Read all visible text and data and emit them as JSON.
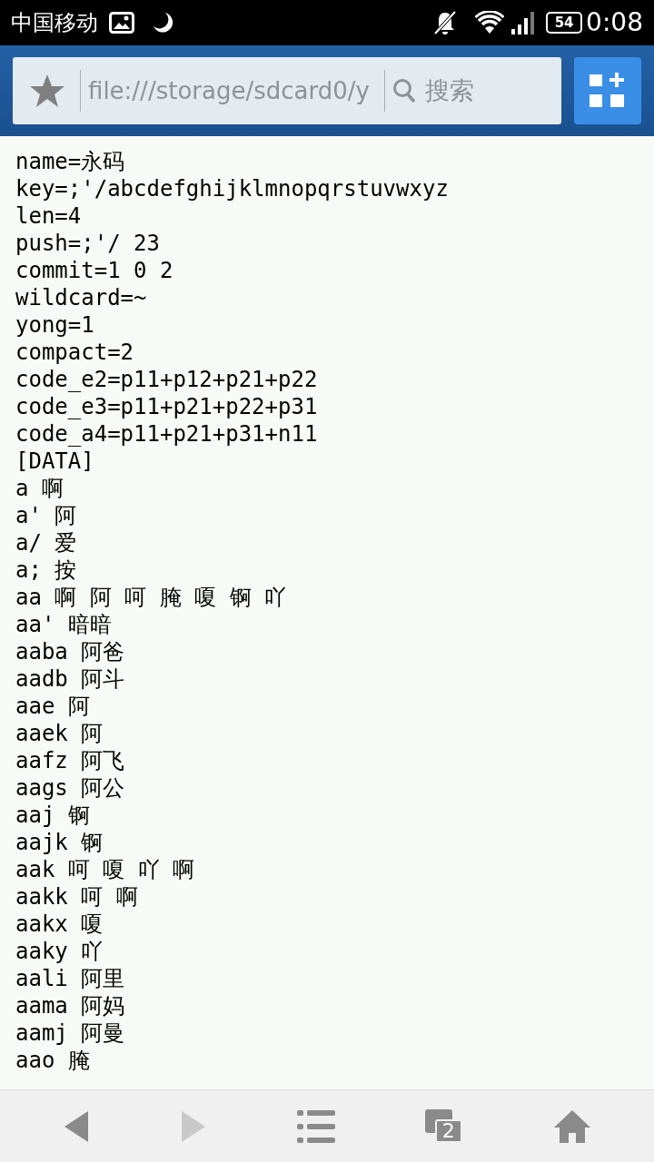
{
  "status_bar": {
    "carrier": "中国移动",
    "battery": "54",
    "time": "0:08"
  },
  "address_bar": {
    "url": "file:///storage/sdcard0/y",
    "search_placeholder": "搜索"
  },
  "lines": [
    "name=永码",
    "key=;'/abcdefghijklmnopqrstuvwxyz",
    "len=4",
    "push=;'/ 23",
    "commit=1 0 2",
    "wildcard=~",
    "yong=1",
    "compact=2",
    "code_e2=p11+p12+p21+p22",
    "code_e3=p11+p21+p22+p31",
    "code_a4=p11+p21+p31+n11",
    "[DATA]",
    "a 啊",
    "a' 阿",
    "a/ 爱",
    "a; 按",
    "aa 啊 阿 呵 腌 嗄 锕 吖",
    "aa' 暗暗",
    "aaba 阿爸",
    "aadb 阿斗",
    "aae 阿",
    "aaek 阿",
    "aafz 阿飞",
    "aags 阿公",
    "aaj 锕",
    "aajk 锕",
    "aak 呵 嗄 吖 啊",
    "aakk 呵 啊",
    "aakx 嗄",
    "aaky 吖",
    "aali 阿里",
    "aama 阿妈",
    "aamj 阿曼",
    "aao 腌"
  ],
  "toolbar": [
    {
      "kind": "back",
      "disabled": false
    },
    {
      "kind": "forward",
      "disabled": true
    },
    {
      "kind": "menu",
      "disabled": false
    },
    {
      "kind": "tabs",
      "count": "2",
      "disabled": false
    },
    {
      "kind": "home",
      "disabled": false
    }
  ]
}
